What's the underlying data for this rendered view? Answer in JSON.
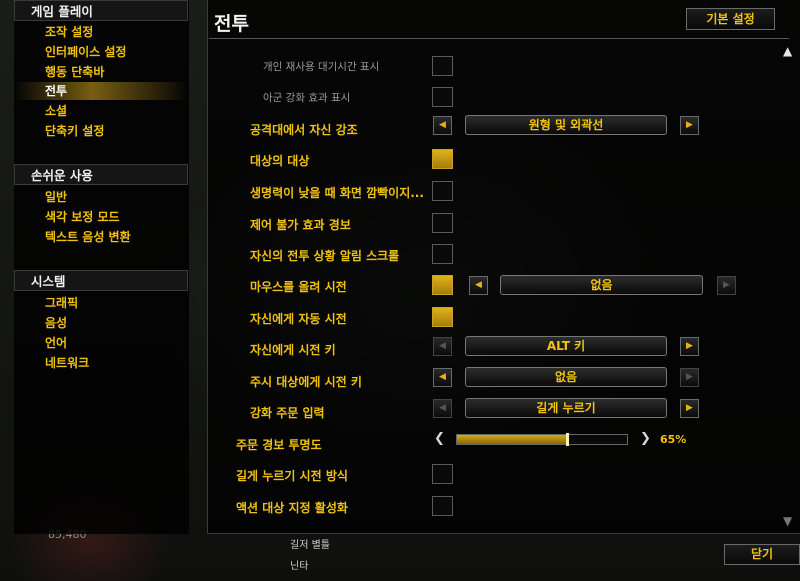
{
  "sidebar": {
    "sections": [
      {
        "header": "게임 플레이",
        "items": [
          "조작 설정",
          "인터페이스 설정",
          "행동 단축바",
          "전투",
          "소셜",
          "단축키 설정"
        ]
      },
      {
        "header": "손쉬운 사용",
        "items": [
          "일반",
          "색각 보정 모드",
          "텍스트 음성 변환"
        ]
      },
      {
        "header": "시스템",
        "items": [
          "그래픽",
          "음성",
          "언어",
          "네트워크"
        ]
      }
    ],
    "selected_item": "전투"
  },
  "panel": {
    "title": "전투",
    "default_button": "기본 설정",
    "close_button": "닫기"
  },
  "rows": [
    {
      "label": "개인 재사용 대기시간 표시",
      "control": "checkbox",
      "checked": false,
      "subdued": true
    },
    {
      "label": "아군 강화 효과 표시",
      "control": "checkbox",
      "checked": false,
      "subdued": true
    },
    {
      "label": "공격대에서 자신 강조",
      "control": "dropdown",
      "value": "원형 및 외곽선"
    },
    {
      "label": "대상의 대상",
      "control": "checkbox",
      "checked": true
    },
    {
      "label": "생명력이 낮을 때 화면 깜빡이지...",
      "control": "checkbox",
      "checked": false
    },
    {
      "label": "제어 불가 효과 경보",
      "control": "checkbox",
      "checked": false
    },
    {
      "label": "자신의 전투 상황 알림 스크롤",
      "control": "checkbox",
      "checked": false
    },
    {
      "label": "마우스를 올려 시전",
      "control": "checkbox+dropdown",
      "checked": true,
      "value": "없음"
    },
    {
      "label": "자신에게 자동 시전",
      "control": "checkbox",
      "checked": true
    },
    {
      "label": "자신에게 시전 키",
      "control": "dropdown",
      "value": "ALT 키"
    },
    {
      "label": "주시 대상에게 시전 키",
      "control": "dropdown",
      "value": "없음"
    },
    {
      "label": "강화 주문 입력",
      "control": "dropdown",
      "value": "길게 누르기"
    },
    {
      "label": "주문 경보 투명도",
      "control": "slider",
      "value_text": "65%",
      "value": 0.65
    },
    {
      "label": "길게 누르기 시전 방식",
      "control": "checkbox",
      "checked": false
    },
    {
      "label": "액션 대상 지정 활성화",
      "control": "checkbox",
      "checked": false
    }
  ],
  "background_fragments": {
    "number": "85,480",
    "list": [
      "길저 별틀",
      "닌타"
    ]
  },
  "colors": {
    "accent": "#f0c20e",
    "checked": "#d4a51a",
    "selected_bg": "#8c6e14"
  }
}
